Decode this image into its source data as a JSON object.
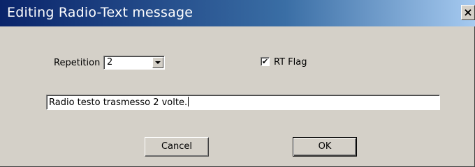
{
  "window": {
    "title": "Editing Radio-Text message",
    "close_glyph": "×"
  },
  "form": {
    "repetition_label": "Repetition",
    "repetition_value": "2",
    "rt_flag_label": "RT Flag",
    "rt_flag_checked": true,
    "rt_flag_glyph": "✔",
    "message_value": "Radio testo trasmesso 2 volte."
  },
  "buttons": {
    "cancel_label": "Cancel",
    "ok_label": "OK"
  },
  "colors": {
    "dialog_bg": "#d4d0c8",
    "titlebar_start": "#0a246a",
    "titlebar_end": "#a6caf0"
  }
}
